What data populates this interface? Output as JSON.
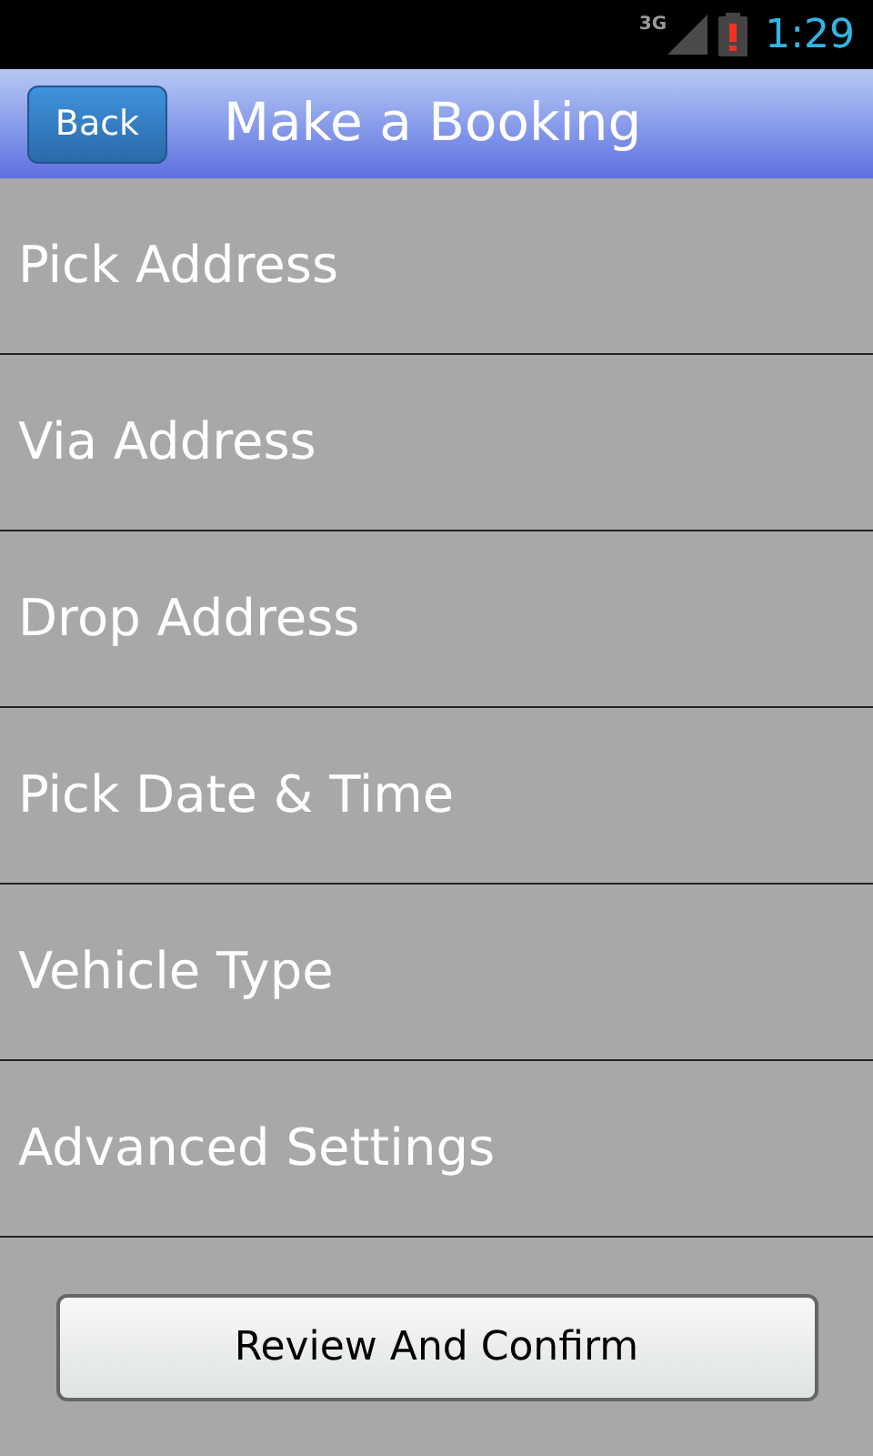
{
  "status_bar": {
    "network": "3G",
    "time": "1:29"
  },
  "header": {
    "back_button": "Back",
    "title": "Make a Booking"
  },
  "menu_items": [
    {
      "label": "Pick Address"
    },
    {
      "label": "Via Address"
    },
    {
      "label": "Drop Address"
    },
    {
      "label": "Pick Date & Time"
    },
    {
      "label": "Vehicle Type"
    },
    {
      "label": "Advanced Settings"
    }
  ],
  "confirm_button": "Review And Confirm"
}
